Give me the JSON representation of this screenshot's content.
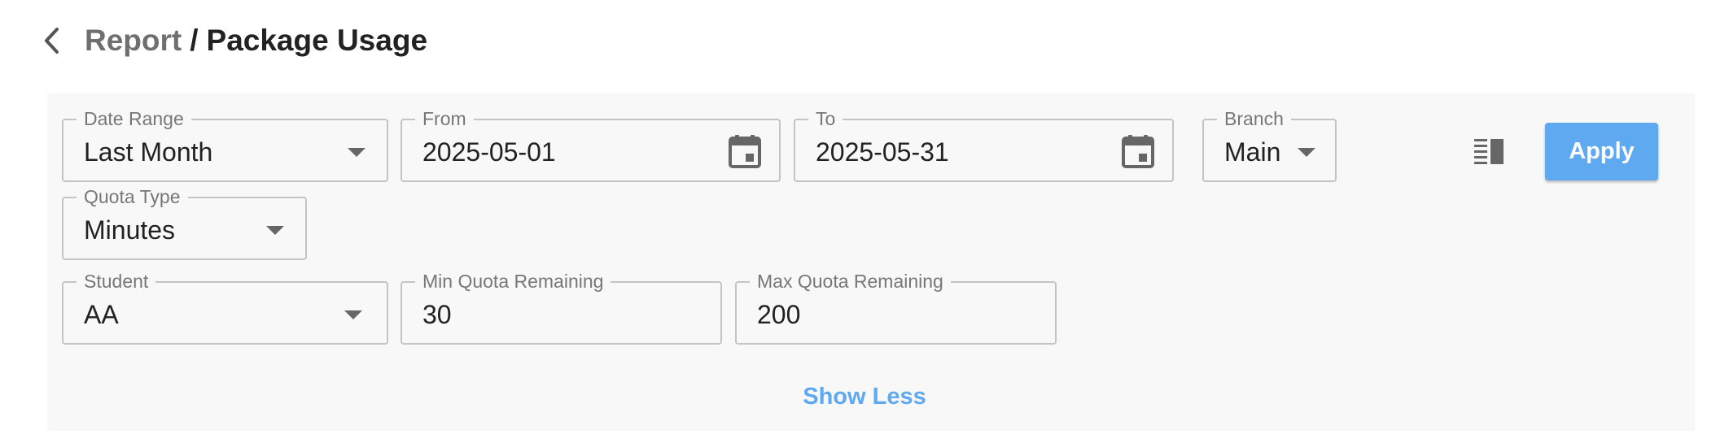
{
  "header": {
    "back_icon": "chevron-left-icon",
    "breadcrumb_parent": "Report",
    "breadcrumb_separator": "/",
    "title": "Package Usage"
  },
  "filters": {
    "date_range": {
      "label": "Date Range",
      "value": "Last Month"
    },
    "from": {
      "label": "From",
      "value": "2025-05-01",
      "icon": "calendar-icon"
    },
    "to": {
      "label": "To",
      "value": "2025-05-31",
      "icon": "calendar-icon"
    },
    "branch": {
      "label": "Branch",
      "value": "Main"
    },
    "quota_type": {
      "label": "Quota Type",
      "value": "Minutes"
    },
    "student": {
      "label": "Student",
      "value": "AA"
    },
    "min_quota": {
      "label": "Min Quota Remaining",
      "value": "30"
    },
    "max_quota": {
      "label": "Max Quota Remaining",
      "value": "200"
    }
  },
  "actions": {
    "layout_icon": "column-layout-icon",
    "apply_label": "Apply",
    "show_less_label": "Show Less"
  },
  "colors": {
    "accent": "#5ea9f0",
    "panel_background": "#f8f8f8",
    "border": "#c4c4c4"
  }
}
